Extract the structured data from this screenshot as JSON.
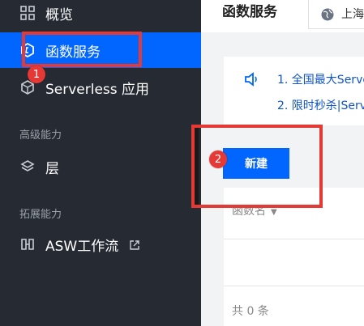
{
  "sidebar": {
    "items": [
      {
        "label": "概览",
        "icon": "grid-icon"
      },
      {
        "label": "函数服务",
        "icon": "function-service-icon"
      },
      {
        "label": "Serverless 应用",
        "icon": "serverless-app-icon"
      },
      {
        "label": "层",
        "icon": "layers-icon"
      },
      {
        "label": "ASW工作流",
        "icon": "workflow-icon"
      }
    ],
    "sections": {
      "advanced": "高级能力",
      "extended": "拓展能力"
    }
  },
  "header": {
    "title": "函数服务",
    "region_label": "上海"
  },
  "notice": {
    "line1": "1. 全国最大Serve",
    "line2": "2. 限时秒杀|Serv"
  },
  "actions": {
    "new_label": "新建"
  },
  "table": {
    "columns": [
      "函数名"
    ],
    "footer": "共 0 条"
  },
  "annotations": {
    "badge1": "1",
    "badge2": "2"
  },
  "colors": {
    "sidebar_bg": "#252a33",
    "accent": "#0066ff",
    "annotation": "#e53935"
  }
}
